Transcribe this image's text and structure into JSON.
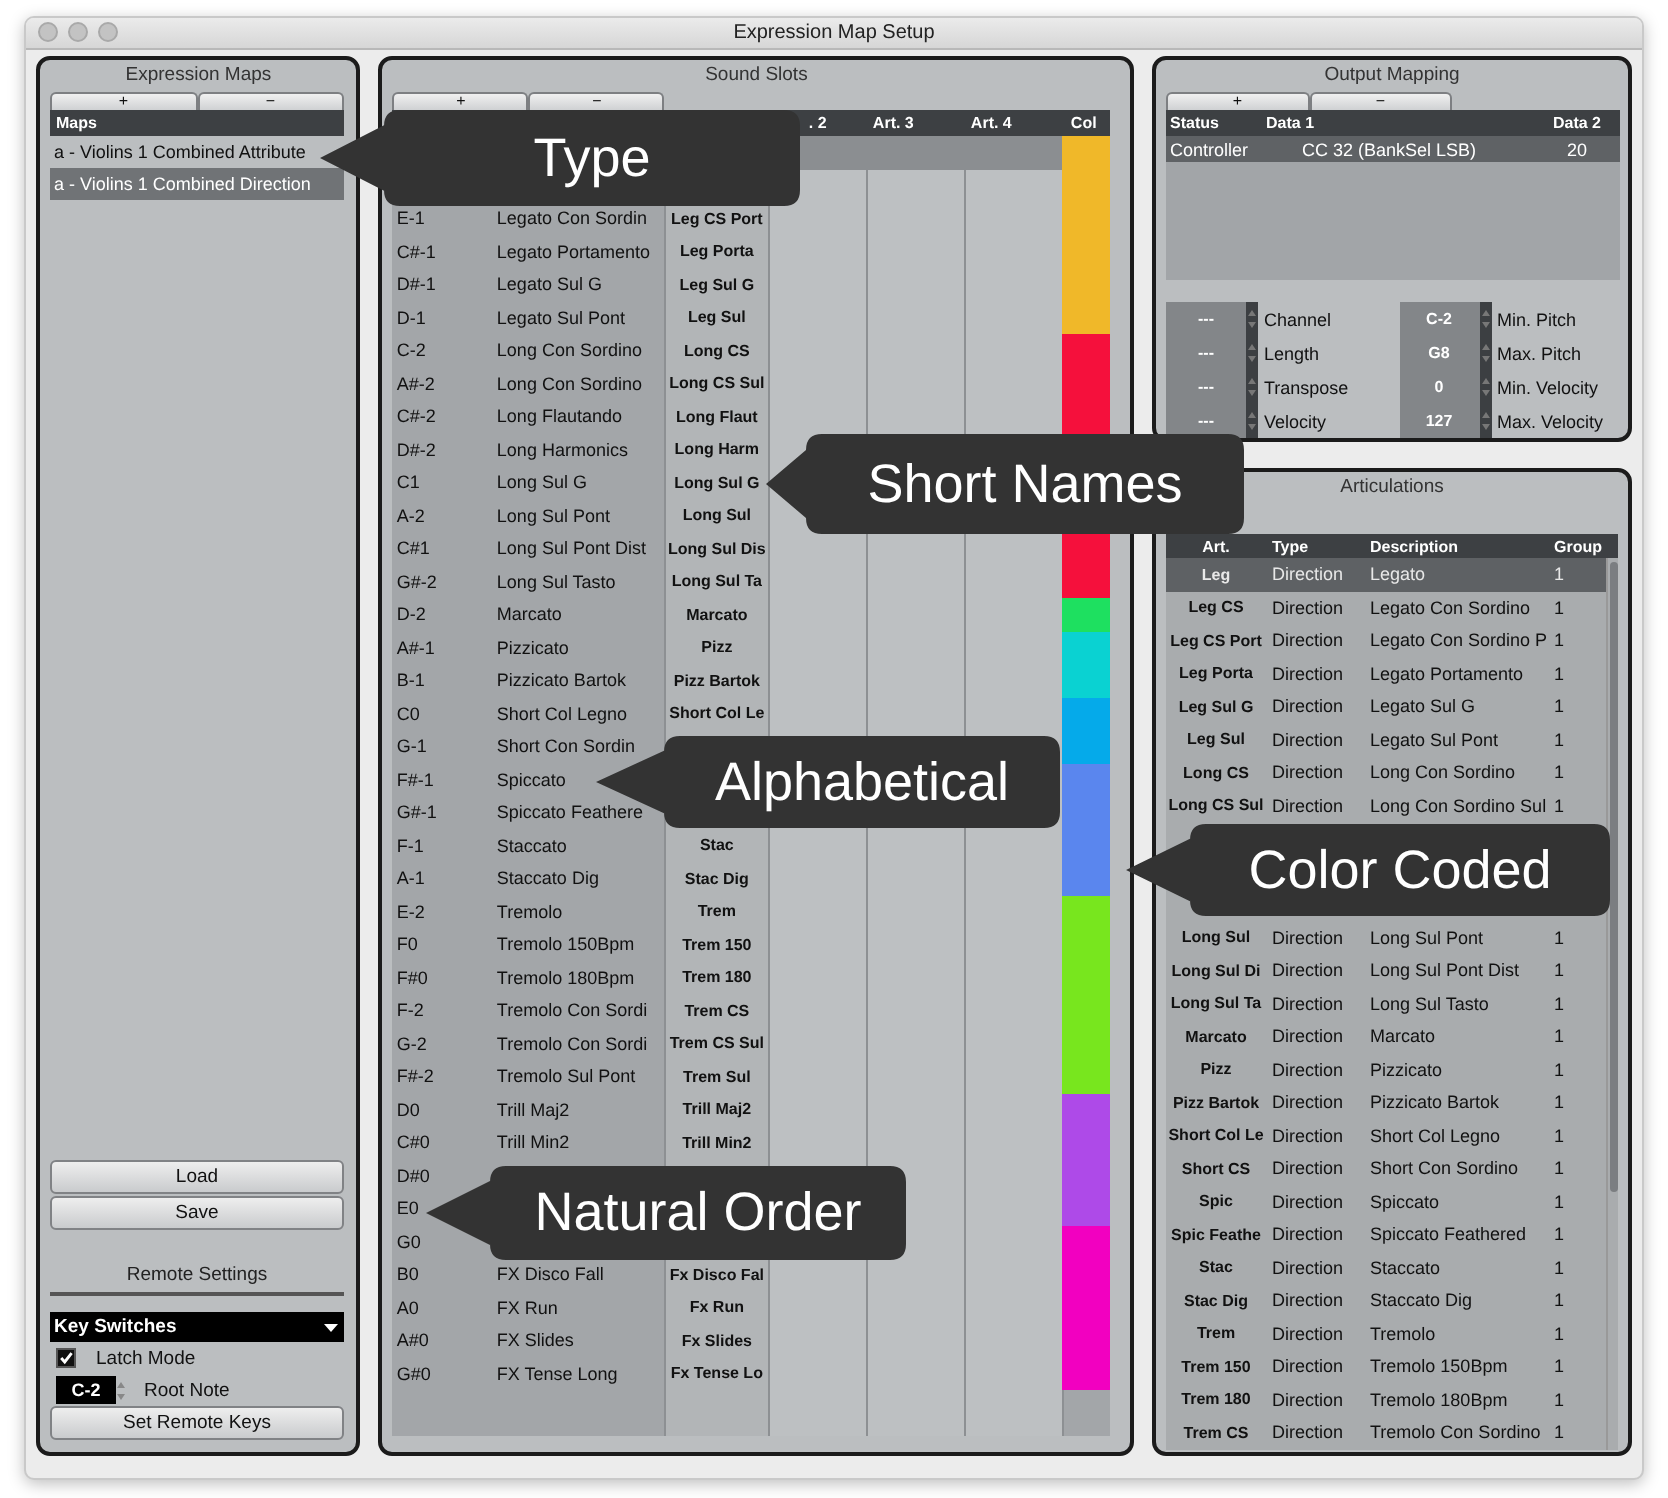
{
  "window": {
    "title": "Expression Map Setup"
  },
  "expression_maps": {
    "title": "Expression Maps",
    "add_button": "+",
    "remove_button": "−",
    "header": "Maps",
    "items": [
      {
        "label": "a - Violins 1 Combined Attribute",
        "selected": false
      },
      {
        "label": "a - Violins 1 Combined Direction",
        "selected": true
      }
    ],
    "load_button": "Load",
    "save_button": "Save"
  },
  "remote_settings": {
    "title": "Remote Settings",
    "mode": "Key Switches",
    "latch": {
      "label": "Latch Mode",
      "checked": true
    },
    "root_note": {
      "value": "C-2",
      "label": "Root Note"
    },
    "set_button": "Set Remote Keys"
  },
  "sound_slots": {
    "title": "Sound Slots",
    "add_button": "+",
    "remove_button": "−",
    "columns": [
      ". 2",
      "Art. 3",
      "Art. 4",
      "Col"
    ],
    "rows": [
      {
        "color": "#f0b829",
        "selected": true
      },
      {
        "color": "#f0b829",
        "selected": false
      },
      {
        "remote": "E-1",
        "name": "Legato Con Sordin",
        "art1": "Leg CS Port",
        "color": "#f0b829",
        "selected": false
      },
      {
        "remote": "C#-1",
        "name": "Legato Portamento",
        "art1": "Leg Porta",
        "color": "#f0b829",
        "selected": false
      },
      {
        "remote": "D#-1",
        "name": "Legato Sul G",
        "art1": "Leg Sul G",
        "color": "#f0b829",
        "selected": false
      },
      {
        "remote": "D-1",
        "name": "Legato Sul Pont",
        "art1": "Leg Sul",
        "color": "#f0b829",
        "selected": false
      },
      {
        "remote": "C-2",
        "name": "Long Con Sordino",
        "art1": "Long CS",
        "color": "#f5103c",
        "selected": false
      },
      {
        "remote": "A#-2",
        "name": "Long Con Sordino",
        "art1": "Long CS Sul",
        "color": "#f5103c",
        "selected": false
      },
      {
        "remote": "C#-2",
        "name": "Long Flautando",
        "art1": "Long Flaut",
        "color": "#f5103c",
        "selected": false
      },
      {
        "remote": "D#-2",
        "name": "Long Harmonics",
        "art1": "Long Harm"
      },
      {
        "remote": "C1",
        "name": "Long Sul G",
        "art1": "Long Sul G"
      },
      {
        "remote": "A-2",
        "name": "Long Sul Pont",
        "art1": "Long Sul"
      },
      {
        "remote": "C#1",
        "name": "Long Sul Pont Dist",
        "art1": "Long Sul Dis",
        "color": "#f5103c",
        "selected": false
      },
      {
        "remote": "G#-2",
        "name": "Long Sul Tasto",
        "art1": "Long Sul Ta",
        "color": "#f5103c",
        "selected": false
      },
      {
        "remote": "D-2",
        "name": "Marcato",
        "art1": "Marcato",
        "color": "#1ee060",
        "selected": false
      },
      {
        "remote": "A#-1",
        "name": "Pizzicato",
        "art1": "Pizz",
        "color": "#0ad2d2",
        "selected": false
      },
      {
        "remote": "B-1",
        "name": "Pizzicato Bartok",
        "art1": "Pizz Bartok",
        "color": "#0ad2d2",
        "selected": false
      },
      {
        "remote": "C0",
        "name": "Short Col Legno",
        "art1": "Short Col Le",
        "color": "#05aaea",
        "selected": false
      },
      {
        "remote": "G-1",
        "name": "Short Con Sordin",
        "color": "#05aaea",
        "selected": false
      },
      {
        "remote": "F#-1",
        "name": "Spiccato",
        "color": "#5a86ee",
        "selected": false
      },
      {
        "remote": "G#-1",
        "name": "Spiccato Feathere",
        "color": "#5a86ee",
        "selected": false
      },
      {
        "remote": "F-1",
        "name": "Staccato",
        "art1": "Stac",
        "color": "#5a86ee",
        "selected": false
      },
      {
        "remote": "A-1",
        "name": "Staccato Dig",
        "art1": "Stac Dig",
        "color": "#5a86ee",
        "selected": false
      },
      {
        "remote": "E-2",
        "name": "Tremolo",
        "art1": "Trem",
        "color": "#78e61e",
        "selected": false
      },
      {
        "remote": "F0",
        "name": "Tremolo 150Bpm",
        "art1": "Trem 150",
        "color": "#78e61e",
        "selected": false
      },
      {
        "remote": "F#0",
        "name": "Tremolo 180Bpm",
        "art1": "Trem 180",
        "color": "#78e61e",
        "selected": false
      },
      {
        "remote": "F-2",
        "name": "Tremolo Con Sordi",
        "art1": "Trem CS",
        "color": "#78e61e",
        "selected": false
      },
      {
        "remote": "G-2",
        "name": "Tremolo Con Sordi",
        "art1": "Trem CS Sul",
        "color": "#78e61e",
        "selected": false
      },
      {
        "remote": "F#-2",
        "name": "Tremolo Sul Pont",
        "art1": "Trem Sul",
        "color": "#78e61e",
        "selected": false
      },
      {
        "remote": "D0",
        "name": "Trill Maj2",
        "art1": "Trill Maj2",
        "color": "#ae4ae8",
        "selected": false
      },
      {
        "remote": "C#0",
        "name": "Trill Min2",
        "art1": "Trill Min2",
        "color": "#ae4ae8",
        "selected": false
      },
      {
        "remote": "D#0",
        "color": "#ae4ae8",
        "selected": false
      },
      {
        "remote": "E0",
        "color": "#ae4ae8",
        "selected": false
      },
      {
        "remote": "G0",
        "color": "#f200c0",
        "selected": false
      },
      {
        "remote": "B0",
        "name": "FX Disco Fall",
        "art1": "Fx Disco Fal",
        "color": "#f200c0",
        "selected": false
      },
      {
        "remote": "A0",
        "name": "FX Run",
        "art1": "Fx Run",
        "color": "#f200c0",
        "selected": false
      },
      {
        "remote": "A#0",
        "name": "FX Slides",
        "art1": "Fx Slides",
        "color": "#f200c0",
        "selected": false
      },
      {
        "remote": "G#0",
        "name": "FX Tense Long",
        "art1": "Fx Tense Lo",
        "color": "#f200c0",
        "selected": false
      }
    ]
  },
  "output_mapping": {
    "title": "Output Mapping",
    "add_button": "+",
    "remove_button": "−",
    "columns": [
      "Status",
      "Data 1",
      "Data 2"
    ],
    "rows": [
      {
        "status": "Controller",
        "data1": "CC 32  (BankSel LSB)",
        "data2": "20",
        "selected": true
      }
    ],
    "field_groups": [
      {
        "fields": [
          {
            "value": "---",
            "label": "Channel"
          },
          {
            "value": "---",
            "label": "Length"
          },
          {
            "value": "---",
            "label": "Transpose"
          },
          {
            "value": "---",
            "label": "Velocity"
          }
        ]
      },
      {
        "fields": [
          {
            "value": "C-2",
            "label": "Min. Pitch"
          },
          {
            "value": "G8",
            "label": "Max. Pitch"
          },
          {
            "value": "0",
            "label": "Min. Velocity"
          },
          {
            "value": "127",
            "label": "Max. Velocity"
          }
        ]
      }
    ]
  },
  "articulations": {
    "title": "Articulations",
    "columns": [
      "Art.",
      "Type",
      "Description",
      "Group"
    ],
    "rows": [
      {
        "kind": "row",
        "art": "Leg",
        "type": "Direction",
        "description": "Legato",
        "group": "1",
        "selected": true
      },
      {
        "kind": "row",
        "art": "Leg CS",
        "type": "Direction",
        "description": "Legato Con Sordino",
        "group": "1",
        "selected": false
      },
      {
        "kind": "row",
        "art": "Leg CS Port",
        "type": "Direction",
        "description": "Legato Con Sordino P",
        "group": "1",
        "selected": false
      },
      {
        "kind": "row",
        "art": "Leg Porta",
        "type": "Direction",
        "description": "Legato Portamento",
        "group": "1",
        "selected": false
      },
      {
        "kind": "row",
        "art": "Leg Sul G",
        "type": "Direction",
        "description": "Legato Sul G",
        "group": "1",
        "selected": false
      },
      {
        "kind": "row",
        "art": "Leg Sul",
        "type": "Direction",
        "description": "Legato Sul Pont",
        "group": "1",
        "selected": false
      },
      {
        "kind": "row",
        "art": "Long CS",
        "type": "Direction",
        "description": "Long Con Sordino",
        "group": "1",
        "selected": false
      },
      {
        "kind": "row",
        "art": "Long CS Sul",
        "type": "Direction",
        "description": "Long Con Sordino Sul",
        "group": "1",
        "selected": false
      },
      {
        "kind": "covered"
      },
      {
        "kind": "covered"
      },
      {
        "kind": "covered"
      },
      {
        "kind": "row",
        "art": "Long Sul",
        "type": "Direction",
        "description": "Long Sul Pont",
        "group": "1",
        "selected": false
      },
      {
        "kind": "row",
        "art": "Long Sul Di",
        "type": "Direction",
        "description": "Long Sul Pont Dist",
        "group": "1",
        "selected": false
      },
      {
        "kind": "row",
        "art": "Long Sul Ta",
        "type": "Direction",
        "description": "Long Sul Tasto",
        "group": "1",
        "selected": false
      },
      {
        "kind": "row",
        "art": "Marcato",
        "type": "Direction",
        "description": "Marcato",
        "group": "1",
        "selected": false
      },
      {
        "kind": "row",
        "art": "Pizz",
        "type": "Direction",
        "description": "Pizzicato",
        "group": "1",
        "selected": false
      },
      {
        "kind": "row",
        "art": "Pizz Bartok",
        "type": "Direction",
        "description": "Pizzicato Bartok",
        "group": "1",
        "selected": false
      },
      {
        "kind": "row",
        "art": "Short Col Le",
        "type": "Direction",
        "description": "Short Col Legno",
        "group": "1",
        "selected": false
      },
      {
        "kind": "row",
        "art": "Short CS",
        "type": "Direction",
        "description": "Short Con Sordino",
        "group": "1",
        "selected": false
      },
      {
        "kind": "row",
        "art": "Spic",
        "type": "Direction",
        "description": "Spiccato",
        "group": "1",
        "selected": false
      },
      {
        "kind": "row",
        "art": "Spic Feathe",
        "type": "Direction",
        "description": "Spiccato Feathered",
        "group": "1",
        "selected": false
      },
      {
        "kind": "row",
        "art": "Stac",
        "type": "Direction",
        "description": "Staccato",
        "group": "1",
        "selected": false
      },
      {
        "kind": "row",
        "art": "Stac Dig",
        "type": "Direction",
        "description": "Staccato Dig",
        "group": "1",
        "selected": false
      },
      {
        "kind": "row",
        "art": "Trem",
        "type": "Direction",
        "description": "Tremolo",
        "group": "1",
        "selected": false
      },
      {
        "kind": "row",
        "art": "Trem 150",
        "type": "Direction",
        "description": "Tremolo 150Bpm",
        "group": "1",
        "selected": false
      },
      {
        "kind": "row",
        "art": "Trem 180",
        "type": "Direction",
        "description": "Tremolo 180Bpm",
        "group": "1",
        "selected": false
      },
      {
        "kind": "row",
        "art": "Trem CS",
        "type": "Direction",
        "description": "Tremolo Con Sordino",
        "group": "1",
        "selected": false
      }
    ]
  },
  "callouts": [
    {
      "text": "Type"
    },
    {
      "text": "Short Names"
    },
    {
      "text": "Alphabetical"
    },
    {
      "text": "Color Coded"
    },
    {
      "text": "Natural Order"
    }
  ]
}
